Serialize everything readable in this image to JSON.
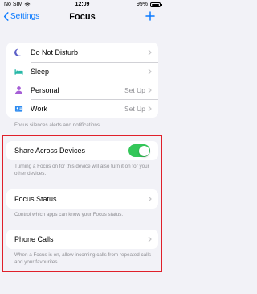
{
  "status": {
    "carrier": "No SIM",
    "time": "12:09",
    "battery": "99%"
  },
  "nav": {
    "back_label": "Settings",
    "title": "Focus"
  },
  "focus_modes": [
    {
      "label": "Do Not Disturb",
      "value": "",
      "icon": "moon-icon",
      "color": "#5b5fc7"
    },
    {
      "label": "Sleep",
      "value": "",
      "icon": "bed-icon",
      "color": "#28b8a7"
    },
    {
      "label": "Personal",
      "value": "Set Up",
      "icon": "person-icon",
      "color": "#a65fd6"
    },
    {
      "label": "Work",
      "value": "Set Up",
      "icon": "id-badge-icon",
      "color": "#2f8cf0"
    }
  ],
  "focus_modes_footer": "Focus silences alerts and notifications.",
  "share_across_devices": {
    "label": "Share Across Devices",
    "enabled": true,
    "footer": "Turning a Focus on for this device will also turn it on for your other devices."
  },
  "focus_status": {
    "label": "Focus Status",
    "footer": "Control which apps can know your Focus status."
  },
  "phone_calls": {
    "label": "Phone Calls",
    "footer": "When a Focus is on, allow incoming calls from repeated calls and your favourites."
  },
  "colors": {
    "accent": "#0a7aff",
    "toggle_on": "#34c759",
    "highlight": "#e0202a"
  }
}
